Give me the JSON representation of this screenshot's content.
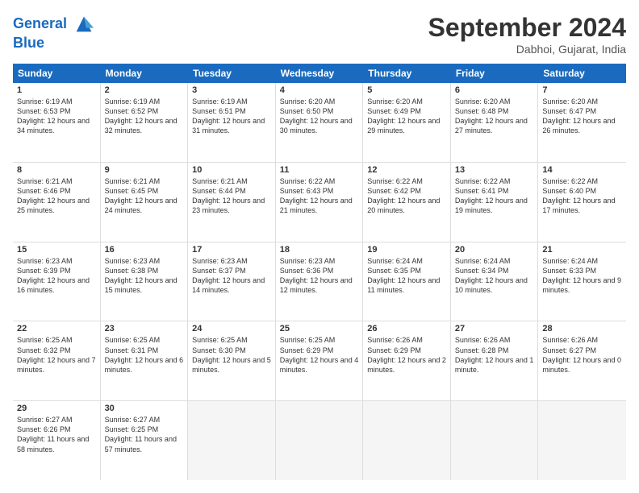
{
  "header": {
    "logo_line1": "General",
    "logo_line2": "Blue",
    "month_title": "September 2024",
    "location": "Dabhoi, Gujarat, India"
  },
  "weekdays": [
    "Sunday",
    "Monday",
    "Tuesday",
    "Wednesday",
    "Thursday",
    "Friday",
    "Saturday"
  ],
  "weeks": [
    [
      {
        "day": 1,
        "sunrise": "6:19 AM",
        "sunset": "6:53 PM",
        "daylight": "Daylight: 12 hours and 34 minutes."
      },
      {
        "day": 2,
        "sunrise": "6:19 AM",
        "sunset": "6:52 PM",
        "daylight": "Daylight: 12 hours and 32 minutes."
      },
      {
        "day": 3,
        "sunrise": "6:19 AM",
        "sunset": "6:51 PM",
        "daylight": "Daylight: 12 hours and 31 minutes."
      },
      {
        "day": 4,
        "sunrise": "6:20 AM",
        "sunset": "6:50 PM",
        "daylight": "Daylight: 12 hours and 30 minutes."
      },
      {
        "day": 5,
        "sunrise": "6:20 AM",
        "sunset": "6:49 PM",
        "daylight": "Daylight: 12 hours and 29 minutes."
      },
      {
        "day": 6,
        "sunrise": "6:20 AM",
        "sunset": "6:48 PM",
        "daylight": "Daylight: 12 hours and 27 minutes."
      },
      {
        "day": 7,
        "sunrise": "6:20 AM",
        "sunset": "6:47 PM",
        "daylight": "Daylight: 12 hours and 26 minutes."
      }
    ],
    [
      {
        "day": 8,
        "sunrise": "6:21 AM",
        "sunset": "6:46 PM",
        "daylight": "Daylight: 12 hours and 25 minutes."
      },
      {
        "day": 9,
        "sunrise": "6:21 AM",
        "sunset": "6:45 PM",
        "daylight": "Daylight: 12 hours and 24 minutes."
      },
      {
        "day": 10,
        "sunrise": "6:21 AM",
        "sunset": "6:44 PM",
        "daylight": "Daylight: 12 hours and 23 minutes."
      },
      {
        "day": 11,
        "sunrise": "6:22 AM",
        "sunset": "6:43 PM",
        "daylight": "Daylight: 12 hours and 21 minutes."
      },
      {
        "day": 12,
        "sunrise": "6:22 AM",
        "sunset": "6:42 PM",
        "daylight": "Daylight: 12 hours and 20 minutes."
      },
      {
        "day": 13,
        "sunrise": "6:22 AM",
        "sunset": "6:41 PM",
        "daylight": "Daylight: 12 hours and 19 minutes."
      },
      {
        "day": 14,
        "sunrise": "6:22 AM",
        "sunset": "6:40 PM",
        "daylight": "Daylight: 12 hours and 17 minutes."
      }
    ],
    [
      {
        "day": 15,
        "sunrise": "6:23 AM",
        "sunset": "6:39 PM",
        "daylight": "Daylight: 12 hours and 16 minutes."
      },
      {
        "day": 16,
        "sunrise": "6:23 AM",
        "sunset": "6:38 PM",
        "daylight": "Daylight: 12 hours and 15 minutes."
      },
      {
        "day": 17,
        "sunrise": "6:23 AM",
        "sunset": "6:37 PM",
        "daylight": "Daylight: 12 hours and 14 minutes."
      },
      {
        "day": 18,
        "sunrise": "6:23 AM",
        "sunset": "6:36 PM",
        "daylight": "Daylight: 12 hours and 12 minutes."
      },
      {
        "day": 19,
        "sunrise": "6:24 AM",
        "sunset": "6:35 PM",
        "daylight": "Daylight: 12 hours and 11 minutes."
      },
      {
        "day": 20,
        "sunrise": "6:24 AM",
        "sunset": "6:34 PM",
        "daylight": "Daylight: 12 hours and 10 minutes."
      },
      {
        "day": 21,
        "sunrise": "6:24 AM",
        "sunset": "6:33 PM",
        "daylight": "Daylight: 12 hours and 9 minutes."
      }
    ],
    [
      {
        "day": 22,
        "sunrise": "6:25 AM",
        "sunset": "6:32 PM",
        "daylight": "Daylight: 12 hours and 7 minutes."
      },
      {
        "day": 23,
        "sunrise": "6:25 AM",
        "sunset": "6:31 PM",
        "daylight": "Daylight: 12 hours and 6 minutes."
      },
      {
        "day": 24,
        "sunrise": "6:25 AM",
        "sunset": "6:30 PM",
        "daylight": "Daylight: 12 hours and 5 minutes."
      },
      {
        "day": 25,
        "sunrise": "6:25 AM",
        "sunset": "6:29 PM",
        "daylight": "Daylight: 12 hours and 4 minutes."
      },
      {
        "day": 26,
        "sunrise": "6:26 AM",
        "sunset": "6:29 PM",
        "daylight": "Daylight: 12 hours and 2 minutes."
      },
      {
        "day": 27,
        "sunrise": "6:26 AM",
        "sunset": "6:28 PM",
        "daylight": "Daylight: 12 hours and 1 minute."
      },
      {
        "day": 28,
        "sunrise": "6:26 AM",
        "sunset": "6:27 PM",
        "daylight": "Daylight: 12 hours and 0 minutes."
      }
    ],
    [
      {
        "day": 29,
        "sunrise": "6:27 AM",
        "sunset": "6:26 PM",
        "daylight": "Daylight: 11 hours and 58 minutes."
      },
      {
        "day": 30,
        "sunrise": "6:27 AM",
        "sunset": "6:25 PM",
        "daylight": "Daylight: 11 hours and 57 minutes."
      },
      null,
      null,
      null,
      null,
      null
    ]
  ]
}
